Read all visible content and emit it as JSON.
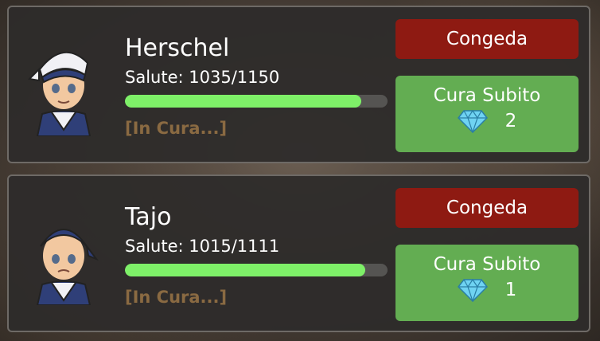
{
  "characters": [
    {
      "name": "Herschel",
      "health_text": "Salute: 1035/1150",
      "health_fraction": 0.9,
      "status": "[In Cura...]",
      "freeze_label": "Congeda",
      "heal_label": "Cura Subito",
      "gem_cost": "2"
    },
    {
      "name": "Tajo",
      "health_text": "Salute: 1015/1111",
      "health_fraction": 0.914,
      "status": "[In Cura...]",
      "freeze_label": "Congeda",
      "heal_label": "Cura Subito",
      "gem_cost": "1"
    }
  ],
  "colors": {
    "health_fill": "#7ef068",
    "freeze_button": "#8e1a12",
    "heal_button": "#63ad52",
    "status_text": "#8a6a42"
  },
  "icons": {
    "currency": "diamond-icon"
  }
}
